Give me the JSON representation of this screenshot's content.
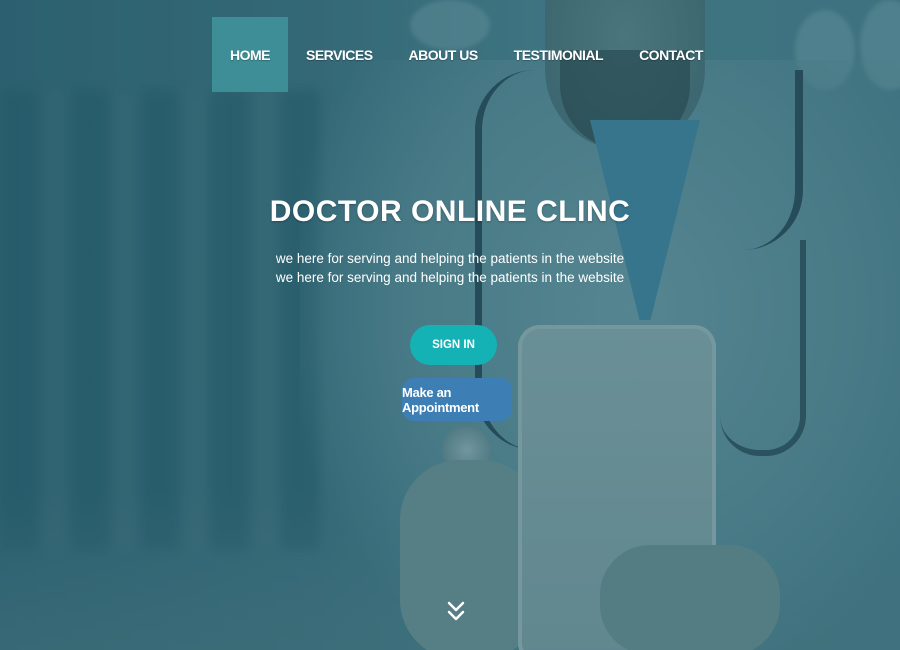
{
  "nav": {
    "items": [
      {
        "label": "HOME",
        "active": true
      },
      {
        "label": "SERVICES",
        "active": false
      },
      {
        "label": "ABOUT US",
        "active": false
      },
      {
        "label": "TESTIMONIAL",
        "active": false
      },
      {
        "label": "CONTACT",
        "active": false
      }
    ]
  },
  "hero": {
    "title": "DOCTOR ONLINE CLINC",
    "tagline_line1": "we here for serving and helping the patients in the website",
    "tagline_line2": "we here for serving and helping the patients in the website",
    "sign_in_label": "SIGN IN",
    "appointment_label": "Make an Appointment"
  },
  "icons": {
    "scroll": "double-chevron-down-icon"
  },
  "colors": {
    "active_nav": "#3d8e96",
    "sign_in_button": "#15b2b5",
    "appointment_button": "#3d7fb4",
    "overlay": "#2b6472"
  }
}
